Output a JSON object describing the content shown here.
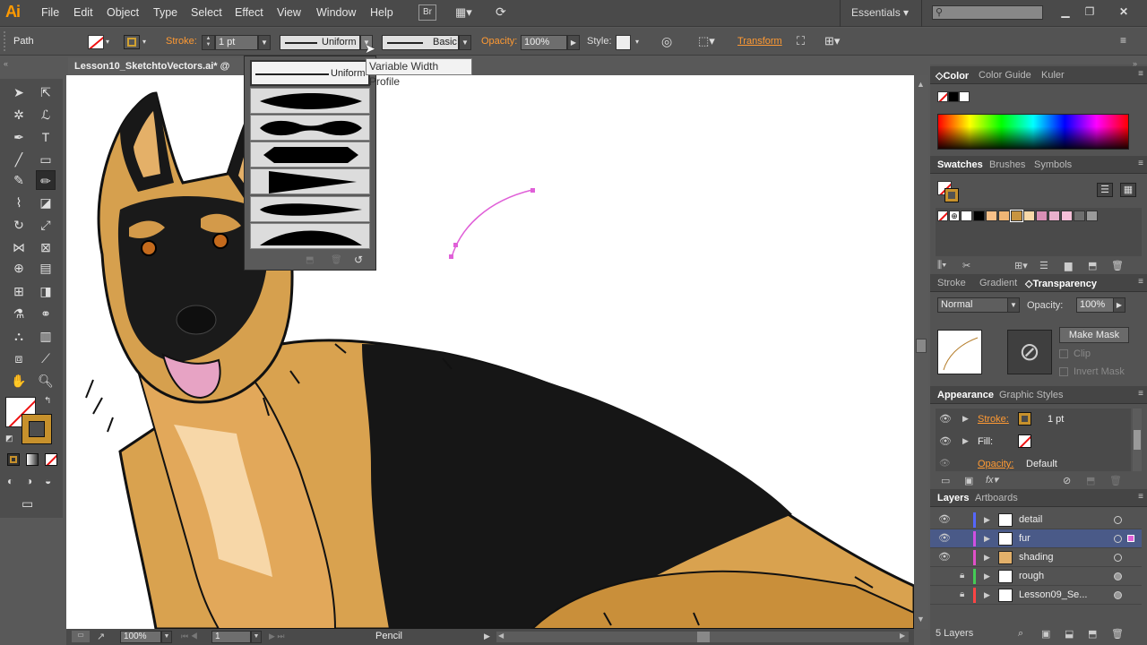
{
  "app": {
    "logo": "Ai"
  },
  "menu": {
    "items": [
      "File",
      "Edit",
      "Object",
      "Type",
      "Select",
      "Effect",
      "View",
      "Window",
      "Help"
    ],
    "bridge_label": "Br",
    "workspace": "Essentials",
    "search_placeholder": ""
  },
  "control": {
    "selection_label": "Path",
    "stroke_label": "Stroke:",
    "stroke_weight": "1 pt",
    "profile_label": "Uniform",
    "brush_label": "Basic",
    "opacity_label": "Opacity:",
    "opacity_value": "100%",
    "style_label": "Style:",
    "transform_label": "Transform"
  },
  "document": {
    "tab_title": "Lesson10_SketchtoVectors.ai* @ 100"
  },
  "popup": {
    "selected_profile": "Uniform",
    "tooltip": "Variable Width Profile"
  },
  "status": {
    "zoom": "100%",
    "artboard": "1",
    "tool": "Pencil"
  },
  "color_panel": {
    "tabs": [
      "Color",
      "Color Guide",
      "Kuler"
    ]
  },
  "swatches_panel": {
    "tabs": [
      "Swatches",
      "Brushes",
      "Symbols"
    ],
    "swatch_colors": [
      "#ffffff",
      "#000000",
      "#f7c088",
      "#f0b575",
      "#c89440",
      "#f8d8a8",
      "#d98fb5",
      "#e9b0cc",
      "#f5c0d8",
      "#6e6e6e",
      "#9a9a9a"
    ]
  },
  "transparency_panel": {
    "tabs": [
      "Stroke",
      "Gradient",
      "Transparency"
    ],
    "blend_mode": "Normal",
    "opacity_label": "Opacity:",
    "opacity_value": "100%",
    "make_mask": "Make Mask",
    "clip": "Clip",
    "invert_mask": "Invert Mask"
  },
  "appearance_panel": {
    "tabs": [
      "Appearance",
      "Graphic Styles"
    ],
    "stroke_label": "Stroke:",
    "stroke_value": "1 pt",
    "fill_label": "Fill:",
    "opacity_label": "Opacity:",
    "opacity_value": "Default"
  },
  "layers_panel": {
    "tabs": [
      "Layers",
      "Artboards"
    ],
    "layers": [
      {
        "name": "detail",
        "color": "#5566ff"
      },
      {
        "name": "fur",
        "color": "#d050e0"
      },
      {
        "name": "shading",
        "color": "#e050c8"
      },
      {
        "name": "rough",
        "color": "#44cc55"
      },
      {
        "name": "Lesson09_Se...",
        "color": "#ff4444"
      }
    ],
    "count": "5 Layers"
  },
  "colors": {
    "accent": "#ff9a33",
    "path_selection": "#e060d8",
    "selected_layer_bg": "#4a5a88"
  }
}
